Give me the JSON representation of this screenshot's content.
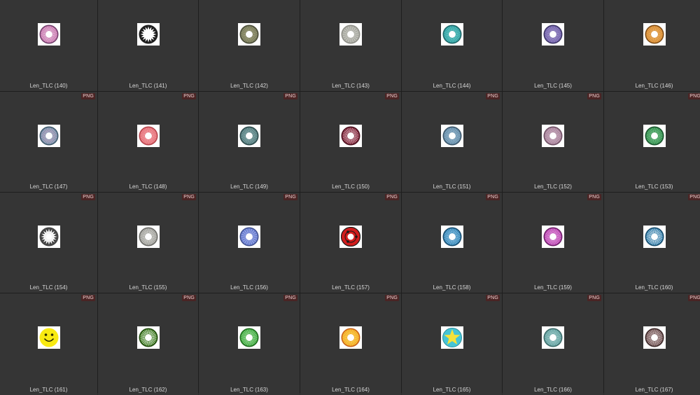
{
  "gallery": {
    "badge_text": "PNG",
    "items": [
      {
        "label": "Len_TLC (140)",
        "badge": false,
        "icon": "lens-pink-ring-icon",
        "style": "ring",
        "colors": [
          "#c36fa8",
          "#f1d6ea",
          "#6f3f6a"
        ]
      },
      {
        "label": "Len_TLC (141)",
        "badge": false,
        "icon": "lens-black-star-icon",
        "style": "star",
        "colors": [
          "#1e1e1e",
          "#ffffff",
          "#1e1e1e"
        ]
      },
      {
        "label": "Len_TLC (142)",
        "badge": false,
        "icon": "lens-olive-icon",
        "style": "ring",
        "colors": [
          "#6e7254",
          "#b7b38c",
          "#4a4c38"
        ]
      },
      {
        "label": "Len_TLC (143)",
        "badge": false,
        "icon": "lens-gray-icon",
        "style": "solid",
        "colors": [
          "#a9aaa2",
          "#d6d6cf",
          "#8d8d86"
        ]
      },
      {
        "label": "Len_TLC (144)",
        "badge": false,
        "icon": "lens-aqua-icon",
        "style": "ring",
        "colors": [
          "#2a9a9b",
          "#7fd9d8",
          "#1f6668"
        ]
      },
      {
        "label": "Len_TLC (145)",
        "badge": false,
        "icon": "lens-violet-icon",
        "style": "ring",
        "colors": [
          "#6a5aa6",
          "#b9acd8",
          "#3c3464"
        ]
      },
      {
        "label": "Len_TLC (146)",
        "badge": false,
        "icon": "lens-amber-icon",
        "style": "ring",
        "colors": [
          "#d4862c",
          "#f3c07a",
          "#7a4a16"
        ]
      },
      {
        "label": "Len_TLC (147)",
        "badge": true,
        "icon": "lens-blue-pink-icon",
        "style": "ring",
        "colors": [
          "#6c8fa6",
          "#e8b6d4",
          "#40586a"
        ]
      },
      {
        "label": "Len_TLC (148)",
        "badge": true,
        "icon": "lens-coral-icon",
        "style": "ring",
        "colors": [
          "#e36a72",
          "#f7b2b6",
          "#b4444c"
        ]
      },
      {
        "label": "Len_TLC (149)",
        "badge": true,
        "icon": "lens-teal-gray-icon",
        "style": "ring",
        "colors": [
          "#4d7476",
          "#9fc1c0",
          "#2d4a4b"
        ]
      },
      {
        "label": "Len_TLC (150)",
        "badge": true,
        "icon": "lens-maroon-ring-icon",
        "style": "ring",
        "colors": [
          "#7a1f33",
          "#f2d7de",
          "#4b1220"
        ]
      },
      {
        "label": "Len_TLC (151)",
        "badge": true,
        "icon": "lens-steel-blue-icon",
        "style": "ring",
        "colors": [
          "#5f86a2",
          "#a9c8dd",
          "#3c566a"
        ]
      },
      {
        "label": "Len_TLC (152)",
        "badge": true,
        "icon": "lens-mauve-icon",
        "style": "ring",
        "colors": [
          "#a27c95",
          "#d8c0cf",
          "#6e4f63"
        ]
      },
      {
        "label": "Len_TLC (153)",
        "badge": true,
        "icon": "lens-green-icon",
        "style": "ring",
        "colors": [
          "#2e8a49",
          "#8fd3a1",
          "#1c5530"
        ]
      },
      {
        "label": "Len_TLC (154)",
        "badge": true,
        "icon": "lens-gray-star-icon",
        "style": "star",
        "colors": [
          "#444444",
          "#f4f4f4",
          "#222222"
        ]
      },
      {
        "label": "Len_TLC (155)",
        "badge": true,
        "icon": "lens-light-gray-icon",
        "style": "ring",
        "colors": [
          "#9a9a95",
          "#e3e3df",
          "#6c6c68"
        ]
      },
      {
        "label": "Len_TLC (156)",
        "badge": true,
        "icon": "lens-periwinkle-icon",
        "style": "solid",
        "colors": [
          "#6a7ed0",
          "#b6c1ef",
          "#40508e"
        ]
      },
      {
        "label": "Len_TLC (157)",
        "badge": true,
        "icon": "lens-red-sharingan-icon",
        "style": "red",
        "colors": [
          "#d11d1d",
          "#ffffff",
          "#1a1a1a"
        ]
      },
      {
        "label": "Len_TLC (158)",
        "badge": true,
        "icon": "lens-blue-spoke-icon",
        "style": "ring",
        "colors": [
          "#2f7fb1",
          "#a8d8f2",
          "#1a4e70"
        ]
      },
      {
        "label": "Len_TLC (159)",
        "badge": true,
        "icon": "lens-magenta-icon",
        "style": "ring",
        "colors": [
          "#b63fae",
          "#f0b6ea",
          "#6c1f67"
        ]
      },
      {
        "label": "Len_TLC (160)",
        "badge": true,
        "icon": "lens-blue-ring-icon",
        "style": "ring",
        "colors": [
          "#2a78a6",
          "#ffffff",
          "#1b4e6d"
        ]
      },
      {
        "label": "Len_TLC (161)",
        "badge": true,
        "icon": "lens-smiley-icon",
        "style": "smiley",
        "colors": [
          "#f8ea11",
          "#2b2b00",
          "#f8ea11"
        ]
      },
      {
        "label": "Len_TLC (162)",
        "badge": true,
        "icon": "lens-olive-green-icon",
        "style": "ring",
        "colors": [
          "#3c7a1e",
          "#ffffff",
          "#234c10"
        ]
      },
      {
        "label": "Len_TLC (163)",
        "badge": true,
        "icon": "lens-bright-green-icon",
        "style": "ring",
        "colors": [
          "#3aa63a",
          "#b7eab4",
          "#1f6c1f"
        ]
      },
      {
        "label": "Len_TLC (164)",
        "badge": true,
        "icon": "lens-orange-yellow-icon",
        "style": "ring",
        "colors": [
          "#f0a21f",
          "#ffe66a",
          "#c8611a"
        ]
      },
      {
        "label": "Len_TLC (165)",
        "badge": true,
        "icon": "lens-star-icon",
        "style": "starshape",
        "colors": [
          "#45c4d6",
          "#f4e23a",
          "#2d8e9c"
        ]
      },
      {
        "label": "Len_TLC (166)",
        "badge": true,
        "icon": "lens-sea-green-icon",
        "style": "ring",
        "colors": [
          "#5d9b9a",
          "#b6dcdb",
          "#3c6b6a"
        ]
      },
      {
        "label": "Len_TLC (167)",
        "badge": true,
        "icon": "lens-brown-icon",
        "style": "ring",
        "colors": [
          "#6b4f4f",
          "#e4d4d4",
          "#3f2c2c"
        ]
      }
    ]
  }
}
